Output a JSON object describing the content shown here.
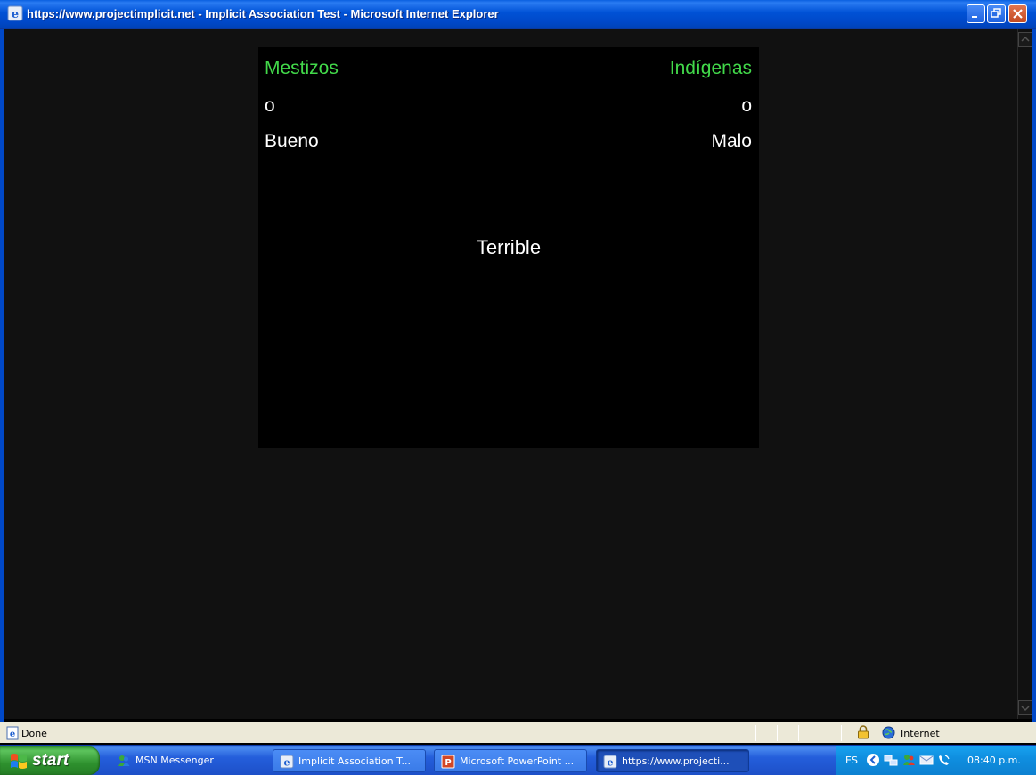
{
  "window": {
    "title": "https://www.projectimplicit.net - Implicit Association Test - Microsoft Internet Explorer"
  },
  "iat": {
    "left_category": "Mestizos",
    "left_connector": "o",
    "left_attribute": "Bueno",
    "right_category": "Indígenas",
    "right_connector": "o",
    "right_attribute": "Malo",
    "stimulus": "Terrible",
    "colors": {
      "category": "#42d94a",
      "attribute": "#ffffff",
      "background": "#000000"
    }
  },
  "statusbar": {
    "status_text": "Done",
    "zone_text": "Internet"
  },
  "taskbar": {
    "start_label": "start",
    "buttons": [
      {
        "label": "MSN Messenger",
        "icon": "msn-messenger-icon"
      },
      {
        "label": "Implicit Association T...",
        "icon": "internet-explorer-icon"
      },
      {
        "label": "Microsoft PowerPoint ...",
        "icon": "powerpoint-icon"
      },
      {
        "label": "https://www.projecti...",
        "icon": "internet-explorer-icon",
        "active": true
      }
    ],
    "tray": {
      "language": "ES",
      "clock": "08:40 p.m."
    }
  }
}
